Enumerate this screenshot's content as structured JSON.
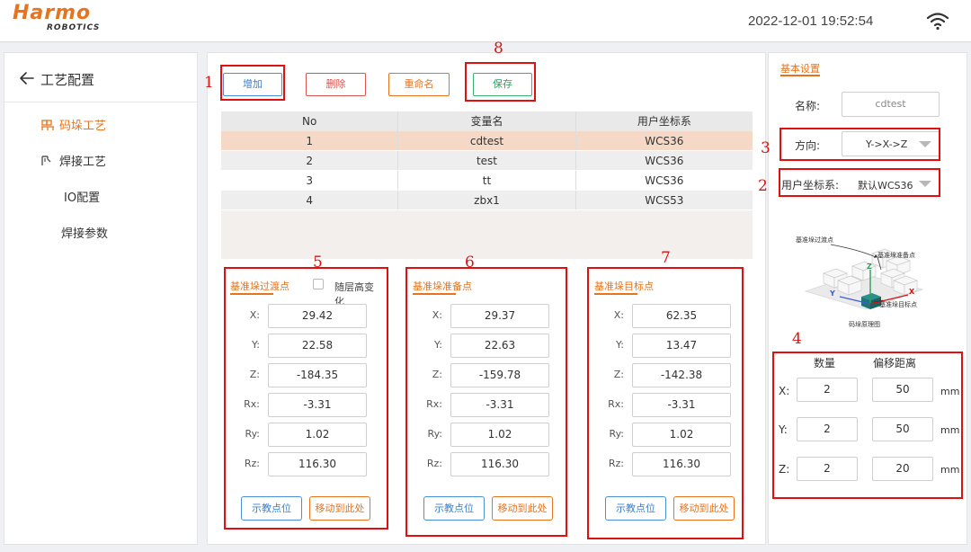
{
  "header": {
    "logo": "Harmo",
    "logo_sub": "ROBOTICS",
    "datetime": "2022-12-01 19:52:54"
  },
  "sidebar": {
    "title": "工艺配置",
    "items": [
      {
        "label": "码垛工艺",
        "active": true,
        "icon": "pallet-icon"
      },
      {
        "label": "焊接工艺",
        "active": false,
        "icon": "welding-icon"
      },
      {
        "label": "IO配置",
        "active": false
      },
      {
        "label": "焊接参数",
        "active": false
      }
    ]
  },
  "toolbar": {
    "add": "增加",
    "delete": "删除",
    "rename": "重命名",
    "save": "保存"
  },
  "table": {
    "columns": [
      "No",
      "变量名",
      "用户坐标系"
    ],
    "rows": [
      {
        "no": "1",
        "name": "cdtest",
        "wcs": "WCS36"
      },
      {
        "no": "2",
        "name": "test",
        "wcs": "WCS36"
      },
      {
        "no": "3",
        "name": "tt",
        "wcs": "WCS36"
      },
      {
        "no": "4",
        "name": "zbx1",
        "wcs": "WCS53"
      }
    ],
    "selected_row": 0
  },
  "panels": [
    {
      "title": "基准垛过渡点",
      "checkbox_label": "随层高变化",
      "fields": [
        {
          "label": "X:",
          "value": "29.42"
        },
        {
          "label": "Y:",
          "value": "22.58"
        },
        {
          "label": "Z:",
          "value": "-184.35"
        },
        {
          "label": "Rx:",
          "value": "-3.31"
        },
        {
          "label": "Ry:",
          "value": "1.02"
        },
        {
          "label": "Rz:",
          "value": "116.30"
        }
      ],
      "teach": "示教点位",
      "move": "移动到此处"
    },
    {
      "title": "基准垛准备点",
      "fields": [
        {
          "label": "X:",
          "value": "29.37"
        },
        {
          "label": "Y:",
          "value": "22.63"
        },
        {
          "label": "Z:",
          "value": "-159.78"
        },
        {
          "label": "Rx:",
          "value": "-3.31"
        },
        {
          "label": "Ry:",
          "value": "1.02"
        },
        {
          "label": "Rz:",
          "value": "116.30"
        }
      ],
      "teach": "示教点位",
      "move": "移动到此处"
    },
    {
      "title": "基准垛目标点",
      "fields": [
        {
          "label": "X:",
          "value": "62.35"
        },
        {
          "label": "Y:",
          "value": "13.47"
        },
        {
          "label": "Z:",
          "value": "-142.38"
        },
        {
          "label": "Rx:",
          "value": "-3.31"
        },
        {
          "label": "Ry:",
          "value": "1.02"
        },
        {
          "label": "Rz:",
          "value": "116.30"
        }
      ],
      "teach": "示教点位",
      "move": "移动到此处"
    }
  ],
  "right": {
    "title": "基本设置",
    "name_label": "名称:",
    "name_value": "cdtest",
    "direction_label": "方向:",
    "direction_value": "Y->X->Z",
    "ucs_label": "用户坐标系:",
    "ucs_value": "默认WCS36",
    "diagram": {
      "label_transition": "基准垛过渡点",
      "label_prepare": "基准垛准备点",
      "label_target": "基准垛目标点",
      "caption": "码垛原理图",
      "axis_x": "X",
      "axis_y": "Y",
      "axis_z": "Z"
    },
    "offset": {
      "col_count": "数量",
      "col_distance": "偏移距离",
      "rows": [
        {
          "label": "X:",
          "count": "2",
          "distance": "50",
          "unit": "mm"
        },
        {
          "label": "Y:",
          "count": "2",
          "distance": "50",
          "unit": "mm"
        },
        {
          "label": "Z:",
          "count": "2",
          "distance": "20",
          "unit": "mm"
        }
      ]
    }
  },
  "annotations": [
    "1",
    "2",
    "3",
    "4",
    "5",
    "6",
    "7",
    "8"
  ],
  "colors": {
    "accent": "#e8731e",
    "annotation": "#e01010",
    "selected_row": "#f5d9c6"
  }
}
